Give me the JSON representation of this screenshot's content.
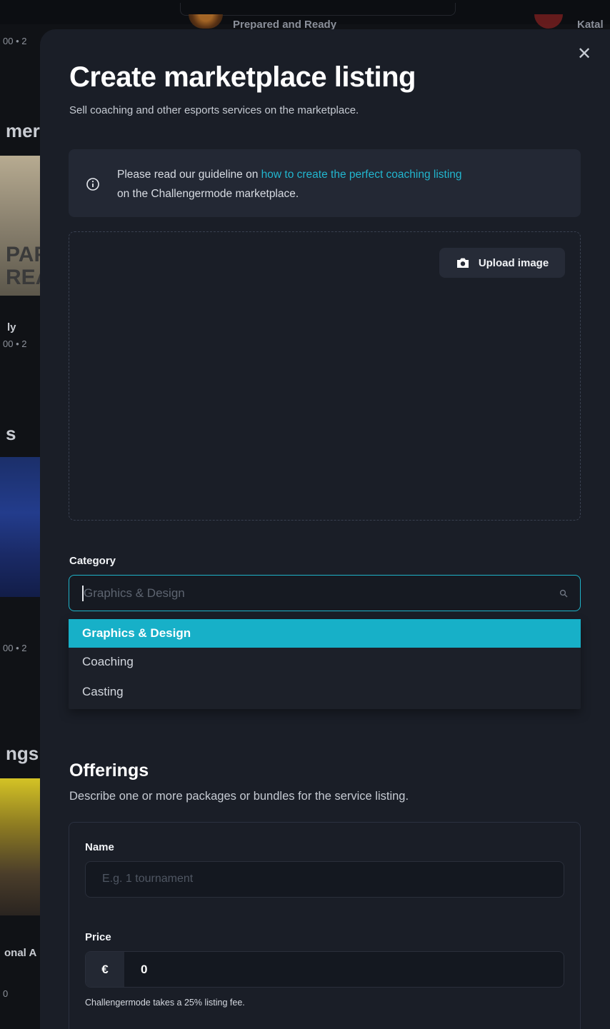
{
  "background": {
    "card1_title": "Prepared and Ready",
    "card2_title": "Katal",
    "fragments": [
      "00 • 2",
      "mer",
      "PAF",
      "REA",
      "ly",
      "00 • 2",
      "s",
      "00 • 2",
      "ngs",
      "onal A",
      "0"
    ]
  },
  "modal": {
    "title": "Create marketplace listing",
    "subtitle": "Sell coaching and other esports services on the marketplace.",
    "close_icon": "close-icon",
    "info": {
      "icon": "info-icon",
      "text_before": "Please read our guideline on ",
      "link_text": "how to create the perfect coaching listing",
      "text_after": " on the Challengermode marketplace."
    },
    "upload": {
      "icon": "camera-icon",
      "label": "Upload image"
    },
    "category": {
      "label": "Category",
      "placeholder": "Graphics & Design",
      "search_icon": "search-icon",
      "options": [
        "Graphics & Design",
        "Coaching",
        "Casting"
      ],
      "highlighted": "Graphics & Design"
    },
    "offerings": {
      "title": "Offerings",
      "subtitle": "Describe one or more packages or bundles for the service listing.",
      "name_label": "Name",
      "name_placeholder": "E.g. 1 tournament",
      "price_label": "Price",
      "currency": "€",
      "price_value": "0",
      "fee_note": "Challengermode takes a 25% listing fee."
    }
  },
  "colors": {
    "accent": "#17b0c8",
    "link": "#22b6cf",
    "modal_bg": "#1a1e27"
  }
}
